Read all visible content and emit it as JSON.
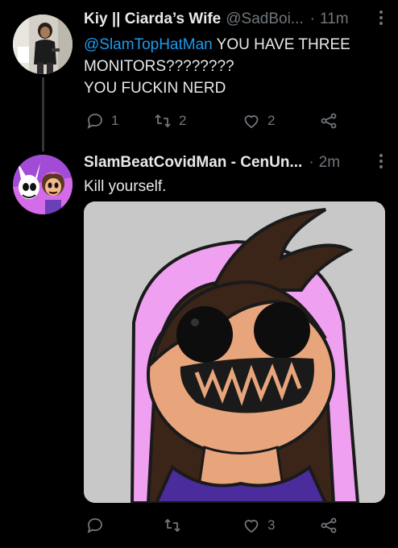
{
  "tweets": [
    {
      "display_name": "Kiy || Ciarda’s Wife",
      "handle": "@SadBoi...",
      "dot": "·",
      "time": "11m",
      "mention": "@SlamTopHatMan",
      "text_after_mention": " YOU HAVE THREE MONITORS????????",
      "text_line2": "YOU FUCKIN NERD",
      "reply_count": "1",
      "retweet_count": "2",
      "like_count": "2",
      "avatar_icon": "user-photo-avatar"
    },
    {
      "display_name": "SlamBeatCovidMan - CenUn...",
      "dot": "·",
      "time": "2m",
      "text": "Kill yourself.",
      "reply_count": "",
      "retweet_count": "",
      "like_count": "3",
      "avatar_icon": "cartoon-avatar",
      "media_icon": "creepy-cartoon-girl-image"
    }
  ],
  "icons": {
    "more": "more-options-icon",
    "reply": "reply-icon",
    "retweet": "retweet-icon",
    "like": "like-icon",
    "share": "share-icon"
  },
  "colors": {
    "background": "#000000",
    "text": "#e7e9ea",
    "muted": "#71767b",
    "accent": "#1d9bf0"
  }
}
